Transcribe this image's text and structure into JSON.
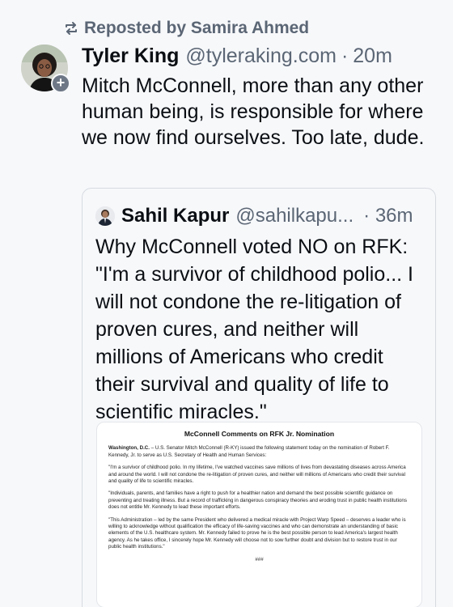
{
  "repost": {
    "label": "Reposted by Samira Ahmed",
    "icon": "repost-icon"
  },
  "post": {
    "author_name": "Tyler King",
    "author_handle": "@tyleraking.com",
    "separator": "·",
    "time": "20m",
    "text": "Mitch McConnell, more than any other human being, is responsible for where we now find ourselves. Too late, dude.",
    "follow_symbol": "+"
  },
  "quote": {
    "author_name": "Sahil Kapur",
    "author_handle": "@sahilkapu...",
    "separator": "·",
    "time": "36m",
    "text": "Why McConnell voted NO on RFK: \"I'm a survivor of childhood polio... I will not condone the re-litigation of proven cures, and neither will millions of Americans who credit their survival and quality of life to scientific miracles.\"",
    "document": {
      "title": "McConnell Comments on RFK Jr. Nomination",
      "dateline": "Washington, D.C.",
      "intro": "– U.S. Senator Mitch McConnell (R-KY) issued the following statement today on the nomination of Robert F. Kennedy, Jr. to serve as U.S. Secretary of Health and Human Services:",
      "para1": "\"I'm a survivor of childhood polio. In my lifetime, I've watched vaccines save millions of lives from devastating diseases across America and around the world. I will not condone the re-litigation of proven cures, and neither will millions of Americans who credit their survival and quality of life to scientific miracles.",
      "para2": "\"Individuals, parents, and families have a right to push for a healthier nation and demand the best possible scientific guidance on preventing and treating illness. But a record of trafficking in dangerous conspiracy theories and eroding trust in public health institutions does not entitle Mr. Kennedy to lead these important efforts.",
      "para3": "\"This Administration – led by the same President who delivered a medical miracle with Project Warp Speed – deserves a leader who is willing to acknowledge without qualification the efficacy of life-saving vaccines and who can demonstrate an understanding of basic elements of the U.S. healthcare system. Mr. Kennedy failed to prove he is the best possible person to lead America's largest health agency. As he takes office, I sincerely hope Mr. Kennedy will choose not to sow further doubt and division but to restore trust in our public health institutions.\"",
      "end": "###"
    }
  }
}
